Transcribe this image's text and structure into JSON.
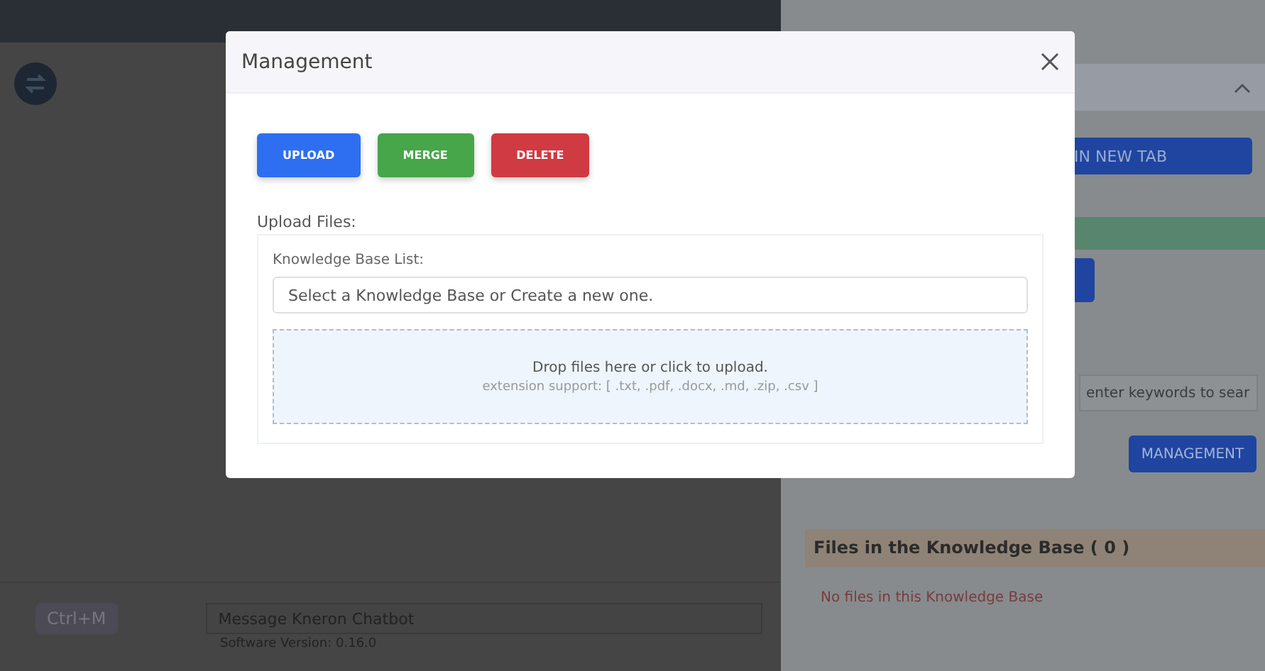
{
  "background": {
    "shortcut": "Ctrl+M",
    "message_field": {
      "placeholder": "Message Kneron Chatbot"
    },
    "version": "Software Version: 0.16.0"
  },
  "settings": {
    "open_button": "IN NEW TAB",
    "search": {
      "placeholder": "enter keywords to sear"
    },
    "management_button": "MANAGEMENT",
    "files_title": "Files in the Knowledge Base ( 0 )",
    "empty_message": "No files in this Knowledge Base"
  },
  "modal": {
    "title": "Management",
    "actions": [
      {
        "label": "UPLOAD",
        "kind": "upload"
      },
      {
        "label": "MERGE",
        "kind": "merge"
      },
      {
        "label": "DELETE",
        "kind": "delete"
      }
    ],
    "section_label": "Upload Files:",
    "list_label": "Knowledge Base List:",
    "kb_field": {
      "placeholder": "Select a Knowledge Base or Create a new one."
    },
    "dropzone": {
      "title": "Drop files here or click to upload.",
      "hint": "extension support: [ .txt, .pdf, .docx, .md, .zip, .csv ]"
    }
  }
}
